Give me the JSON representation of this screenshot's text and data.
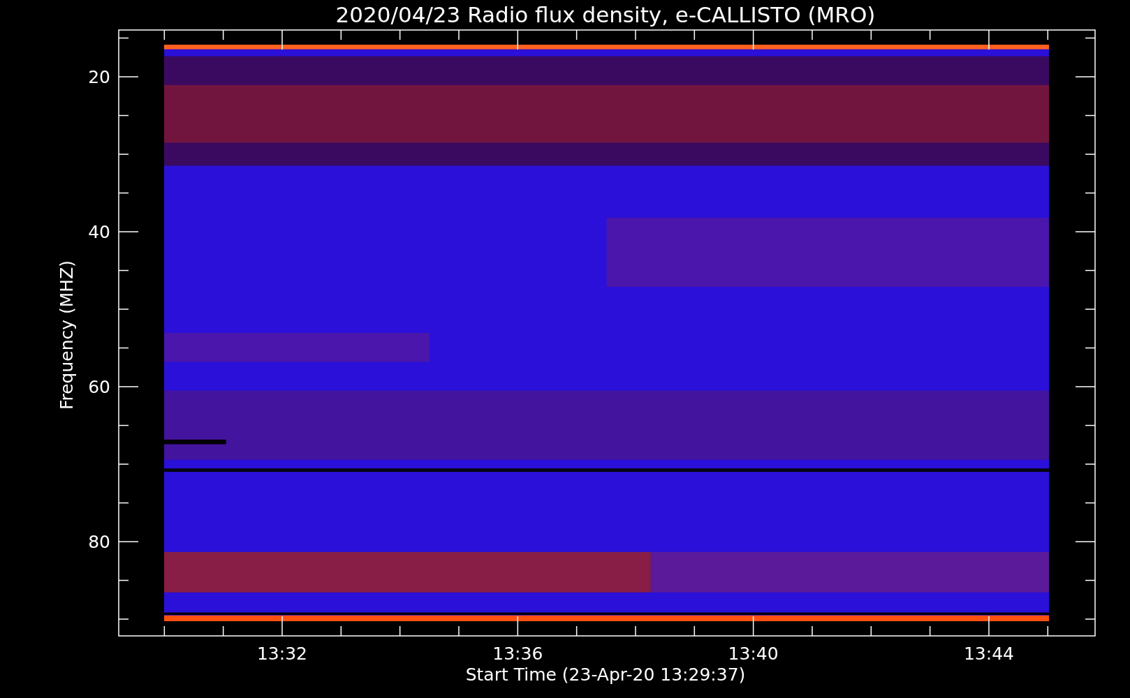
{
  "title": "2020/04/23  Radio flux density, e-CALLISTO (MRO)",
  "y_axis": {
    "label": "Frequency (MHZ)",
    "ticks": [
      "20",
      "40",
      "60",
      "80"
    ]
  },
  "x_axis": {
    "label": "Start Time (23-Apr-20 13:29:37)",
    "ticks": [
      "13:32",
      "13:36",
      "13:40",
      "13:44"
    ]
  }
}
